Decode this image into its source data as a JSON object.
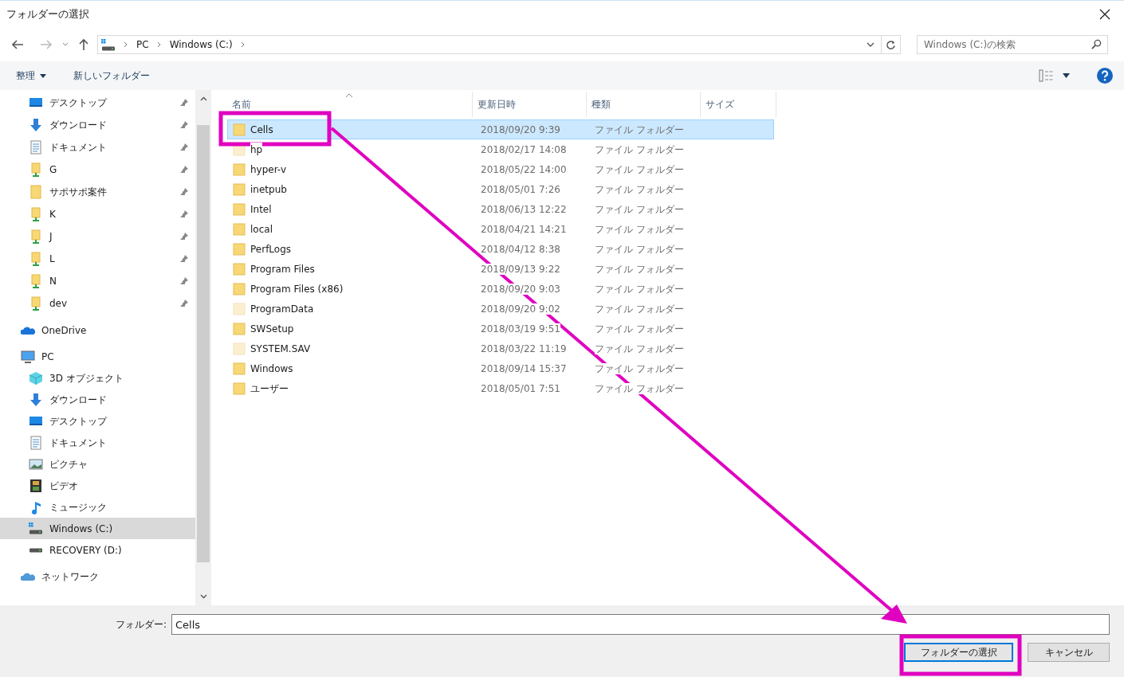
{
  "window": {
    "title": "フォルダーの選択"
  },
  "address": {
    "crumbs": [
      "PC",
      "Windows (C:)"
    ],
    "search_placeholder": "Windows (C:)の検索"
  },
  "toolbar": {
    "organize": "整理",
    "new_folder": "新しいフォルダー"
  },
  "quick_access": [
    {
      "label": "デスクトップ",
      "kind": "desktop",
      "pinned": true
    },
    {
      "label": "ダウンロード",
      "kind": "download",
      "pinned": true
    },
    {
      "label": "ドキュメント",
      "kind": "document",
      "pinned": true
    },
    {
      "label": "G",
      "kind": "share",
      "pinned": true
    },
    {
      "label": "サポサポ案件",
      "kind": "folder",
      "pinned": true
    },
    {
      "label": "K",
      "kind": "share",
      "pinned": true
    },
    {
      "label": "J",
      "kind": "share",
      "pinned": true
    },
    {
      "label": "L",
      "kind": "share",
      "pinned": true
    },
    {
      "label": "N",
      "kind": "share",
      "pinned": true
    },
    {
      "label": "dev",
      "kind": "share",
      "pinned": true
    }
  ],
  "tree": [
    {
      "label": "OneDrive",
      "kind": "cloud",
      "selected": false
    },
    {
      "label": "PC",
      "kind": "pc",
      "selected": false,
      "children": [
        {
          "label": "3D オブジェクト",
          "kind": "cube",
          "selected": false
        },
        {
          "label": "ダウンロード",
          "kind": "download",
          "selected": false
        },
        {
          "label": "デスクトップ",
          "kind": "desktop",
          "selected": false
        },
        {
          "label": "ドキュメント",
          "kind": "document",
          "selected": false
        },
        {
          "label": "ピクチャ",
          "kind": "picture",
          "selected": false
        },
        {
          "label": "ビデオ",
          "kind": "video",
          "selected": false
        },
        {
          "label": "ミュージック",
          "kind": "music",
          "selected": false
        },
        {
          "label": "Windows (C:)",
          "kind": "system_drive",
          "selected": true
        },
        {
          "label": "RECOVERY (D:)",
          "kind": "drive",
          "selected": false
        }
      ]
    },
    {
      "label": "ネットワーク",
      "kind": "network",
      "selected": false
    }
  ],
  "table": {
    "columns": [
      "名前",
      "更新日時",
      "種類",
      "サイズ"
    ],
    "rows": [
      {
        "name": "Cells",
        "date": "2018/09/20 9:39",
        "type": "ファイル フォルダー",
        "hidden": false,
        "selected": true
      },
      {
        "name": "hp",
        "date": "2018/02/17 14:08",
        "type": "ファイル フォルダー",
        "hidden": true,
        "selected": false
      },
      {
        "name": "hyper-v",
        "date": "2018/05/22 14:00",
        "type": "ファイル フォルダー",
        "hidden": false,
        "selected": false
      },
      {
        "name": "inetpub",
        "date": "2018/05/01 7:26",
        "type": "ファイル フォルダー",
        "hidden": false,
        "selected": false
      },
      {
        "name": "Intel",
        "date": "2018/06/13 12:22",
        "type": "ファイル フォルダー",
        "hidden": false,
        "selected": false
      },
      {
        "name": "local",
        "date": "2018/04/21 14:21",
        "type": "ファイル フォルダー",
        "hidden": false,
        "selected": false
      },
      {
        "name": "PerfLogs",
        "date": "2018/04/12 8:38",
        "type": "ファイル フォルダー",
        "hidden": false,
        "selected": false
      },
      {
        "name": "Program Files",
        "date": "2018/09/13 9:22",
        "type": "ファイル フォルダー",
        "hidden": false,
        "selected": false
      },
      {
        "name": "Program Files (x86)",
        "date": "2018/09/20 9:03",
        "type": "ファイル フォルダー",
        "hidden": false,
        "selected": false
      },
      {
        "name": "ProgramData",
        "date": "2018/09/20 9:02",
        "type": "ファイル フォルダー",
        "hidden": true,
        "selected": false
      },
      {
        "name": "SWSetup",
        "date": "2018/03/19 9:51",
        "type": "ファイル フォルダー",
        "hidden": false,
        "selected": false
      },
      {
        "name": "SYSTEM.SAV",
        "date": "2018/03/22 11:19",
        "type": "ファイル フォルダー",
        "hidden": true,
        "selected": false
      },
      {
        "name": "Windows",
        "date": "2018/09/14 15:37",
        "type": "ファイル フォルダー",
        "hidden": false,
        "selected": false
      },
      {
        "name": "ユーザー",
        "date": "2018/05/01 7:51",
        "type": "ファイル フォルダー",
        "hidden": false,
        "selected": false
      }
    ]
  },
  "footer": {
    "folder_label": "フォルダー:",
    "folder_value": "Cells",
    "buttons": [
      "フォルダーの選択",
      "キャンセル"
    ]
  }
}
